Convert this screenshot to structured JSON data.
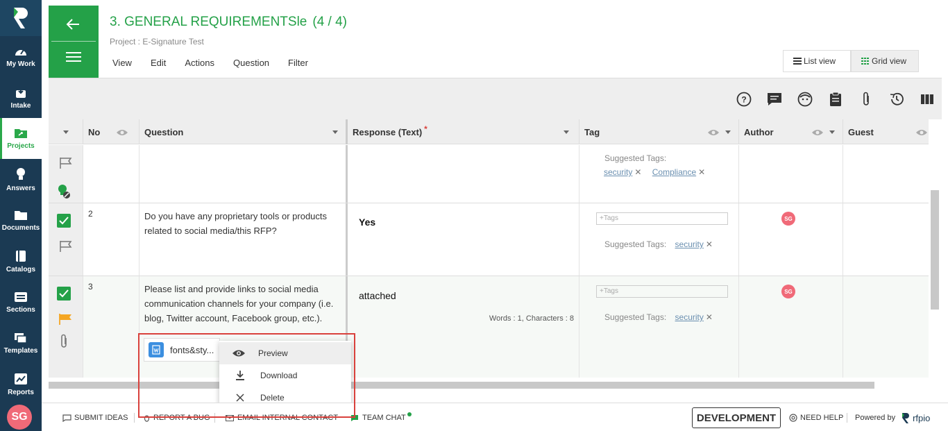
{
  "nav": {
    "items": [
      {
        "label": "My Work"
      },
      {
        "label": "Intake"
      },
      {
        "label": "Projects"
      },
      {
        "label": "Answers"
      },
      {
        "label": "Documents"
      },
      {
        "label": "Catalogs"
      },
      {
        "label": "Sections"
      },
      {
        "label": "Templates"
      },
      {
        "label": "Reports"
      }
    ],
    "user_initials": "SG"
  },
  "header": {
    "title": "3. GENERAL REQUIREMENTSle",
    "count": "(4 / 4)",
    "project": "Project : E-Signature Test",
    "menu": [
      "View",
      "Edit",
      "Actions",
      "Question",
      "Filter"
    ],
    "list_view_label": "List view",
    "grid_view_label": "Grid view"
  },
  "toolbar": {
    "icons": [
      "help-icon",
      "comment-icon",
      "face-icon",
      "clipboard-icon",
      "attachment-icon",
      "history-icon",
      "columns-icon"
    ]
  },
  "grid": {
    "columns": {
      "no": "No",
      "question": "Question",
      "response": "Response (Text)",
      "required_mark": "*",
      "tag": "Tag",
      "author": "Author",
      "guest": "Guest"
    },
    "suggested_label": "Suggested Tags:",
    "tags_placeholder": "+Tags",
    "rows": [
      {
        "no": "",
        "question": "",
        "response": "",
        "suggested_tags": [
          "security",
          "Compliance"
        ]
      },
      {
        "no": "2",
        "question": "Do you have any proprietary tools or products related to social media/this RFP?",
        "response": "Yes",
        "suggested_tags": [
          "security"
        ],
        "author": "SG"
      },
      {
        "no": "3",
        "question": "Please list and provide links to social media communication channels for your company (i.e. blog, Twitter account, Facebook group, etc.).",
        "response": "attached",
        "word_count": "Words : 1, Characters : 8",
        "suggested_tags": [
          "security"
        ],
        "author": "SG",
        "attachment": "fonts&sty..."
      }
    ]
  },
  "context_menu": {
    "items": [
      {
        "label": "Preview"
      },
      {
        "label": "Download"
      },
      {
        "label": "Delete"
      }
    ]
  },
  "footer": {
    "submit_ideas": "SUBMIT IDEAS",
    "report_bug": "REPORT A BUG",
    "email_contact": "EMAIL INTERNAL CONTACT",
    "team_chat": "TEAM CHAT",
    "environment": "DEVELOPMENT",
    "need_help": "NEED HELP",
    "powered_by": "Powered by",
    "brand": "rfpio"
  },
  "colors": {
    "brand_green": "#24a148",
    "nav_dark": "#1b3a53",
    "avatar_pink": "#f06a78",
    "flag_orange": "#f5a623",
    "highlight_red": "#d9413c"
  }
}
